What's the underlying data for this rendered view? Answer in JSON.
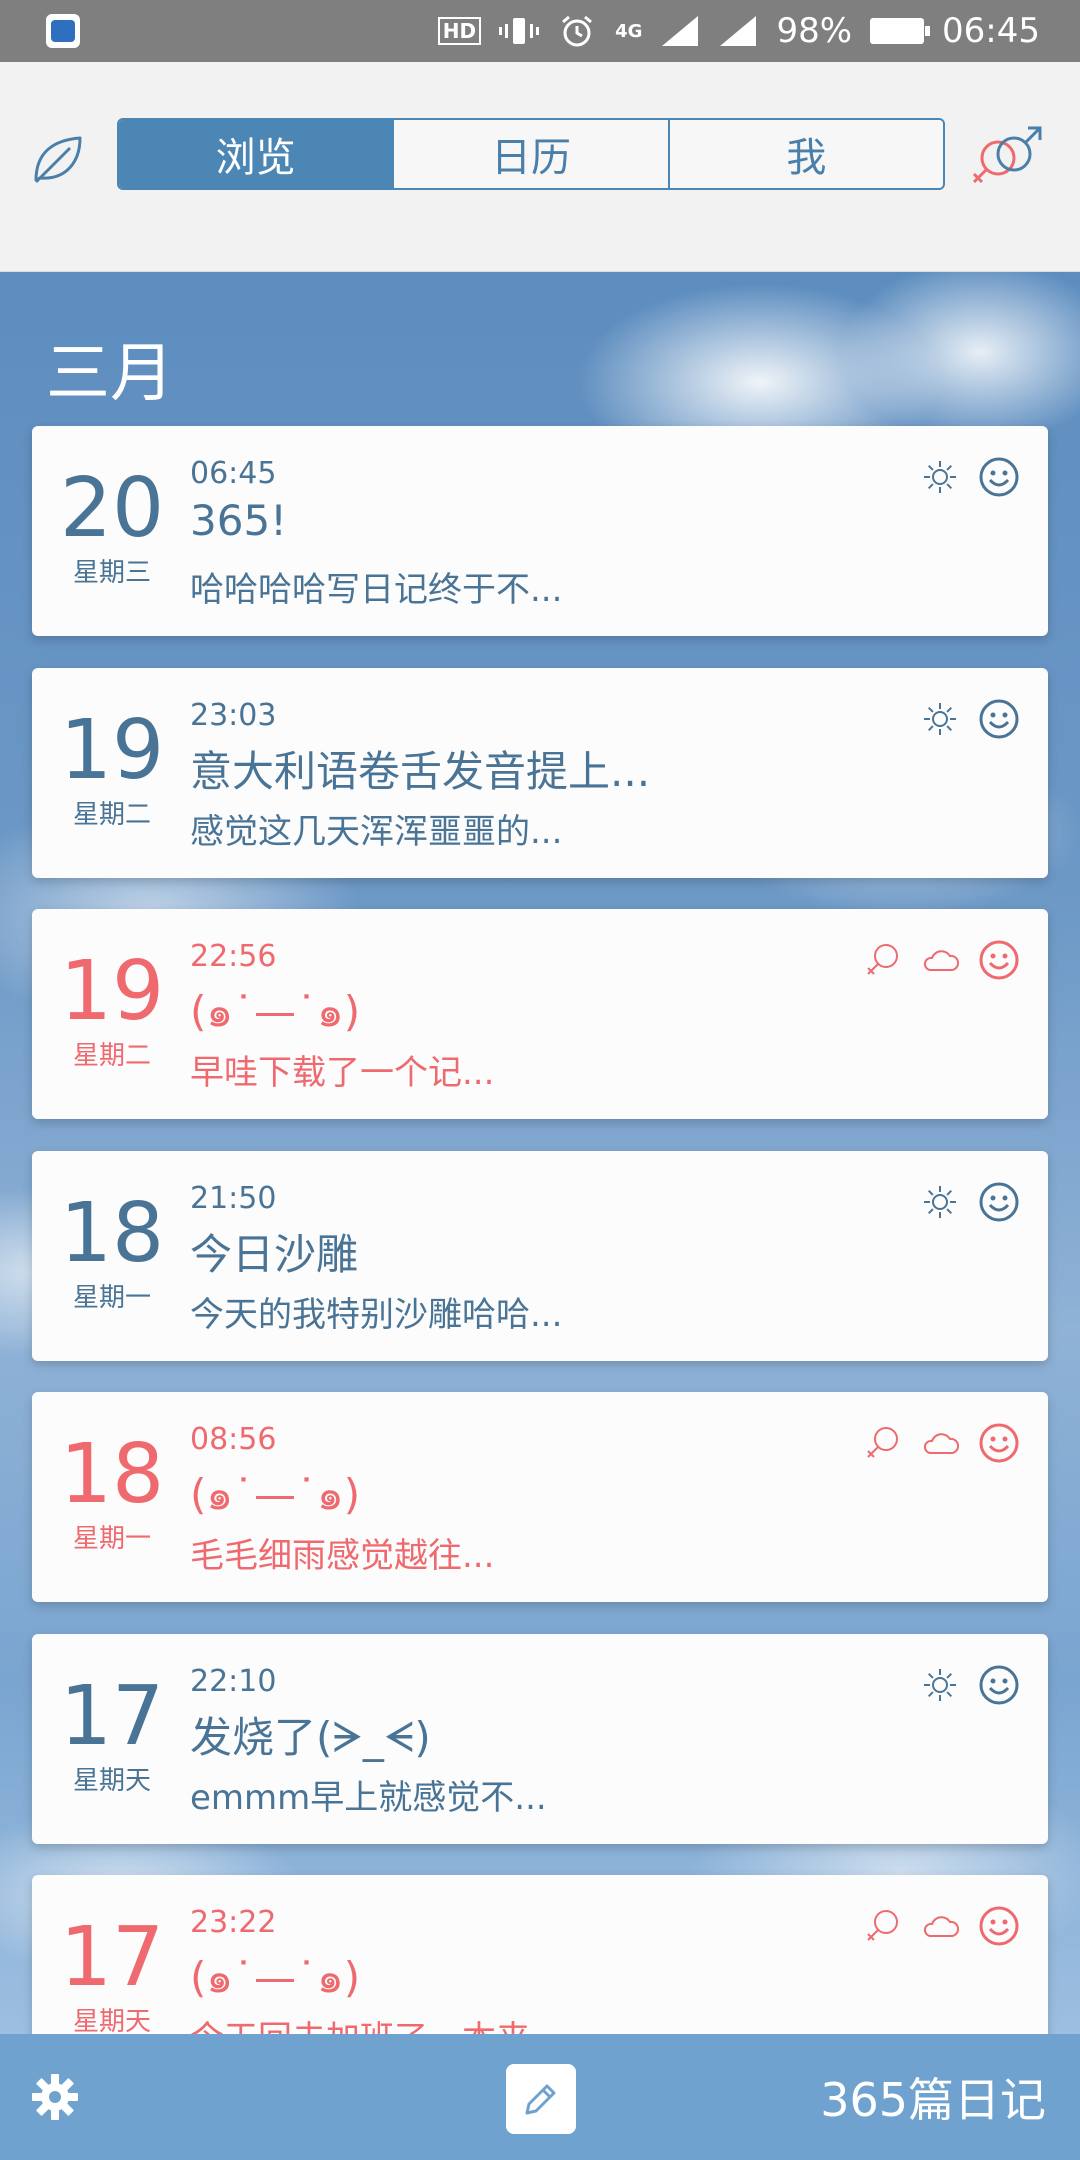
{
  "status_bar": {
    "hd_label": "HD",
    "network": "4G",
    "battery": "98%",
    "time": "06:45"
  },
  "header": {
    "tabs": [
      {
        "label": "浏览",
        "active": true
      },
      {
        "label": "日历",
        "active": false
      },
      {
        "label": "我",
        "active": false
      }
    ]
  },
  "colors": {
    "accent": "#4c86b4",
    "blue_text": "#4a7496",
    "pink_text": "#ee6a6e",
    "bottom_bar": "#6fa2cf"
  },
  "month_label": "三月",
  "entries": [
    {
      "day": "20",
      "weekday": "星期三",
      "time": "06:45",
      "title": "365!",
      "excerpt": "哈哈哈哈写日记终于不...",
      "theme": "blue",
      "icons": [
        "sun-icon",
        "smile-icon"
      ]
    },
    {
      "day": "19",
      "weekday": "星期二",
      "time": "23:03",
      "title": "意大利语卷舌发音提上...",
      "excerpt": "感觉这几天浑浑噩噩的...",
      "theme": "blue",
      "icons": [
        "sun-icon",
        "smile-icon"
      ]
    },
    {
      "day": "19",
      "weekday": "星期二",
      "time": "22:56",
      "title": "(๑˙—˙๑)",
      "excerpt": "早哇下载了一个记...",
      "theme": "pink",
      "icons": [
        "female-icon",
        "cloud-icon",
        "smile-icon"
      ]
    },
    {
      "day": "18",
      "weekday": "星期一",
      "time": "21:50",
      "title": "今日沙雕",
      "excerpt": "今天的我特别沙雕哈哈...",
      "theme": "blue",
      "icons": [
        "sun-icon",
        "smile-icon"
      ]
    },
    {
      "day": "18",
      "weekday": "星期一",
      "time": "08:56",
      "title": "(๑˙—˙๑)",
      "excerpt": "毛毛细雨感觉越往...",
      "theme": "pink",
      "icons": [
        "female-icon",
        "cloud-icon",
        "smile-icon"
      ]
    },
    {
      "day": "17",
      "weekday": "星期天",
      "time": "22:10",
      "title": "发烧了(ᗒ_ᗕ)",
      "excerpt": "emmm早上就感觉不...",
      "theme": "blue",
      "icons": [
        "sun-icon",
        "smile-icon"
      ]
    },
    {
      "day": "17",
      "weekday": "星期天",
      "time": "23:22",
      "title": "(๑˙—˙๑)",
      "excerpt": "今天回去加班了，本来...",
      "theme": "pink",
      "icons": [
        "female-icon",
        "cloud-icon",
        "smile-icon"
      ]
    }
  ],
  "bottom_bar": {
    "count_label": "365篇日记"
  }
}
